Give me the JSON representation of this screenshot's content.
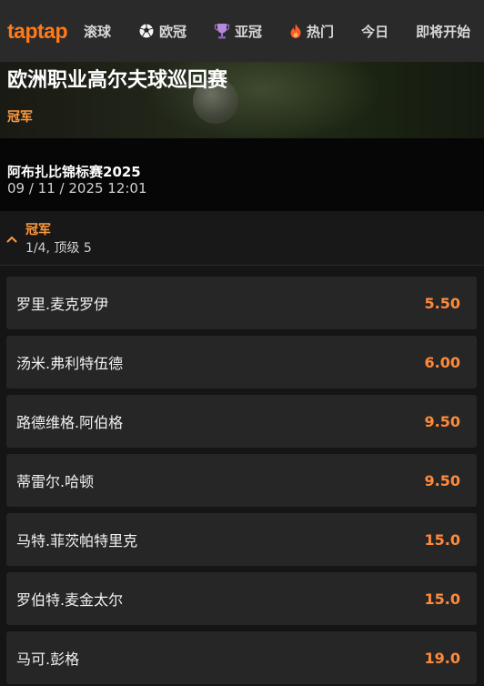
{
  "nav": {
    "logo": "taptap",
    "items": [
      {
        "label": "滚球",
        "icon": ""
      },
      {
        "label": "欧冠",
        "icon": "soccer-ball-icon"
      },
      {
        "label": "亚冠",
        "icon": "trophy-icon"
      },
      {
        "label": "热门",
        "icon": "flame-icon"
      },
      {
        "label": "今日",
        "icon": ""
      },
      {
        "label": "即将开始",
        "icon": ""
      }
    ]
  },
  "hero": {
    "title": "欧洲职业高尔夫球巡回赛",
    "subtitle": "冠军"
  },
  "event": {
    "name": "阿布扎比锦标赛2025",
    "datetime": "09 / 11 / 2025 12:01"
  },
  "market": {
    "title": "冠军",
    "meta": "1/4, 顶级 5"
  },
  "selections": [
    {
      "name": "罗里.麦克罗伊",
      "odds": "5.50"
    },
    {
      "name": "汤米.弗利特伍德",
      "odds": "6.00"
    },
    {
      "name": "路德维格.阿伯格",
      "odds": "9.50"
    },
    {
      "name": "蒂雷尔.哈顿",
      "odds": "9.50"
    },
    {
      "name": "马特.菲茨帕特里克",
      "odds": "15.0"
    },
    {
      "name": "罗伯特.麦金太尔",
      "odds": "15.0"
    },
    {
      "name": "马可.彭格",
      "odds": "19.0"
    }
  ],
  "colors": {
    "accent": "#ff8a3a",
    "nav_bg": "#2a2a2a",
    "row_bg": "#262626"
  }
}
